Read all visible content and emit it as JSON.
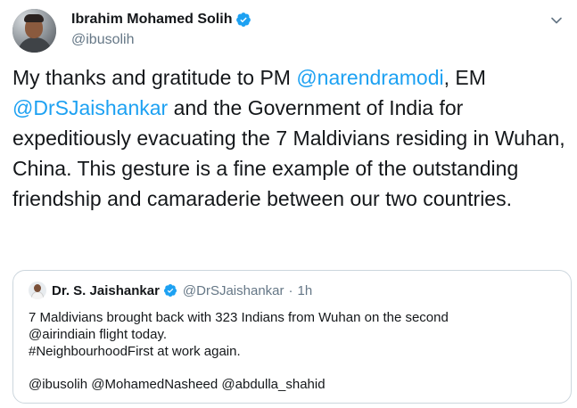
{
  "author": {
    "display_name": "Ibrahim Mohamed Solih",
    "handle": "@ibusolih",
    "avatar_icon": "user-avatar"
  },
  "tweet": {
    "segments": [
      {
        "text": "My thanks and gratitude to PM ",
        "type": "text"
      },
      {
        "text": "@narendramodi",
        "type": "mention"
      },
      {
        "text": ", EM ",
        "type": "text"
      },
      {
        "text": "@DrSJaishankar",
        "type": "mention"
      },
      {
        "text": " and the Government of India for expeditiously evacuating the 7 Maldivians residing in Wuhan, China. This gesture is a fine example of the outstanding friendship and camaraderie between our two countries.",
        "type": "text"
      }
    ]
  },
  "quoted": {
    "display_name": "Dr. S. Jaishankar",
    "handle": "@DrSJaishankar",
    "separator": "·",
    "time": "1h",
    "lines": [
      "7 Maldivians brought back with 323 Indians from Wuhan on the second",
      "@airindiain flight today.",
      "#NeighbourhoodFirst at work again.",
      "",
      "@ibusolih @MohamedNasheed @abdulla_shahid"
    ]
  },
  "colors": {
    "accent": "#1da1f2",
    "text": "#14171a",
    "muted": "#657786",
    "border": "#ccd6dd"
  }
}
